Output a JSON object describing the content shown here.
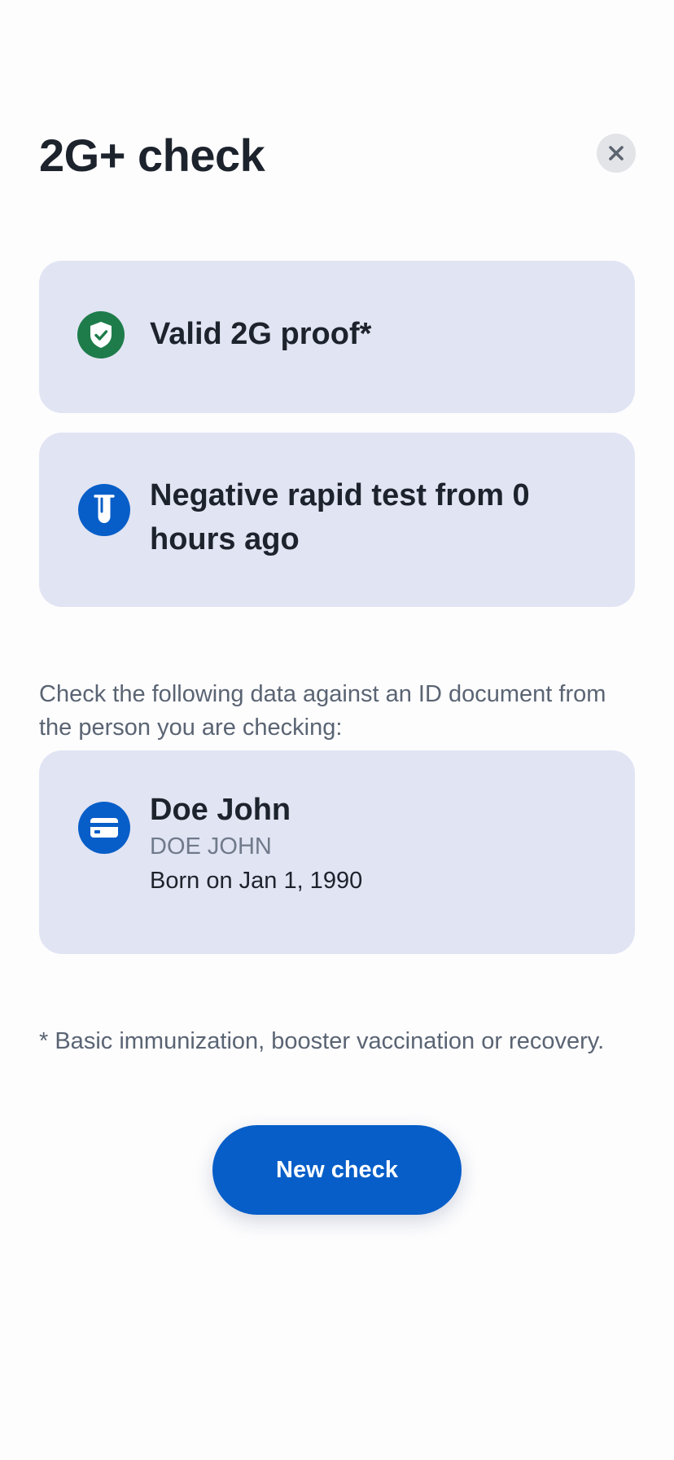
{
  "header": {
    "title": "2G+ check",
    "close_icon": "close-icon"
  },
  "results": {
    "proof": {
      "label": "Valid 2G proof*",
      "icon": "shield-check-icon",
      "icon_color": "#1e7c4a"
    },
    "test": {
      "label": "Negative rapid test from 0 hours ago",
      "icon": "test-tube-icon",
      "icon_color": "#075ec8"
    }
  },
  "instruction": "Check the following data against an ID document from the person you are checking:",
  "person": {
    "name": "Doe John",
    "name_upper": "DOE JOHN",
    "born": "Born on Jan 1, 1990",
    "icon": "id-card-icon",
    "icon_color": "#075ec8"
  },
  "footnote": "* Basic immunization, booster vaccination or recovery.",
  "actions": {
    "new_check_label": "New check"
  },
  "colors": {
    "accent": "#075ec8",
    "card_background": "#e1e4f3",
    "success": "#1e7c4a"
  }
}
